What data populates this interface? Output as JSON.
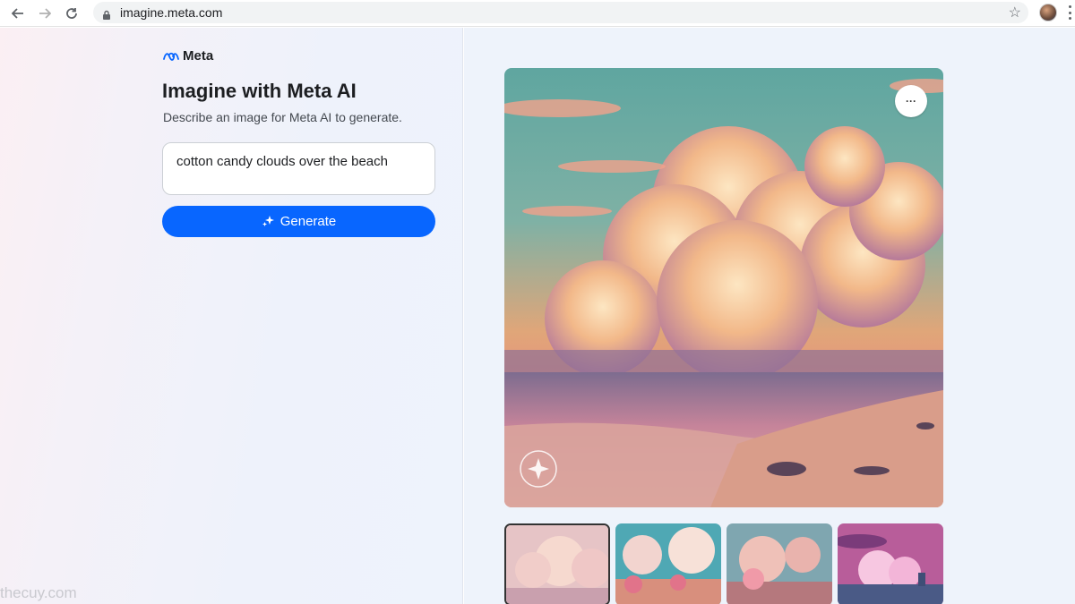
{
  "browser": {
    "url": "imagine.meta.com",
    "icons": [
      "back-arrow-icon",
      "forward-arrow-icon",
      "reload-icon",
      "lock-icon",
      "star-icon",
      "profile-avatar",
      "menu-icon"
    ]
  },
  "brand": {
    "logo": "meta-infinity-logo",
    "name": "Meta"
  },
  "page": {
    "title": "Imagine with Meta AI",
    "subtitle": "Describe an image for Meta AI to generate."
  },
  "prompt": {
    "value": "cotton candy clouds over the beach"
  },
  "generate": {
    "label": "Generate",
    "icon": "sparkle-icon"
  },
  "more_button": {
    "label": "···"
  },
  "watermark": "thecuy.com",
  "colors": {
    "accent": "#0866ff",
    "heading": "#1c1e21"
  },
  "thumbnails": [
    {
      "selected": true
    },
    {
      "selected": false
    },
    {
      "selected": false
    },
    {
      "selected": false
    }
  ]
}
